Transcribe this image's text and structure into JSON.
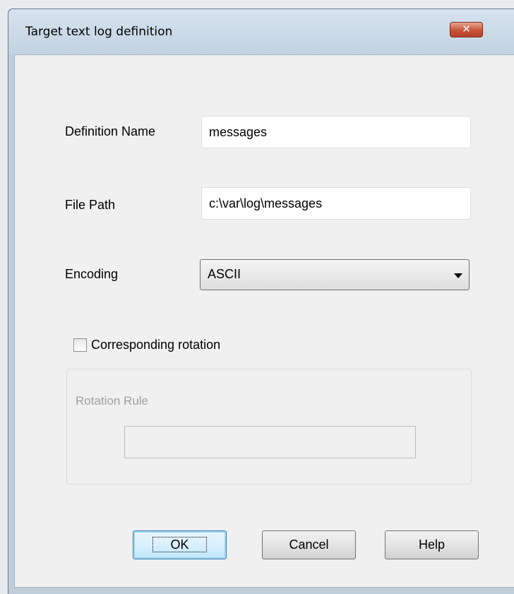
{
  "window": {
    "title": "Target text log definition",
    "close_icon": "close-x-icon"
  },
  "form": {
    "definition_name": {
      "label": "Definition Name",
      "value": "messages"
    },
    "file_path": {
      "label": "File Path",
      "value": "c:\\var\\log\\messages"
    },
    "encoding": {
      "label": "Encoding",
      "value": "ASCII",
      "dropdown_icon": "chevron-down-icon"
    },
    "corresponding_rotation": {
      "label": "Corresponding rotation",
      "checked": false
    },
    "rotation_rule": {
      "label": "Rotation Rule",
      "value": "",
      "disabled": true
    }
  },
  "buttons": {
    "ok": "OK",
    "cancel": "Cancel",
    "help": "Help"
  },
  "colors": {
    "close_button": "#c7533a",
    "disabled_text": "#a0a0a0",
    "default_button_border": "#3c7fb1"
  }
}
